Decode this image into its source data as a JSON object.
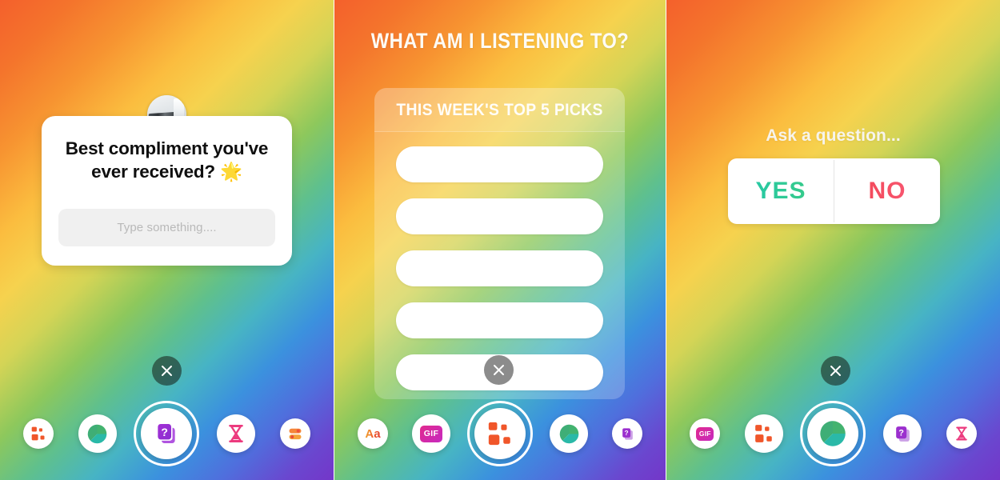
{
  "app": {
    "name": "instagram-story-stickers",
    "panel_count": 3
  },
  "theme": {
    "background_gradient": [
      "#f4602c",
      "#fbbd3f",
      "#8dc85c",
      "#3b91de",
      "#7436c9"
    ],
    "sticker_white": "#ffffff",
    "yes_color_start": "#1fc8b0",
    "yes_color_end": "#3ecb7e",
    "no_color_start": "#f0414d",
    "no_color_end": "#fb5f7e",
    "quiz_orange": "#f0562a",
    "gif_pink": "#e12a8e",
    "question_purple": "#9b2fce",
    "countdown_pink": "#ec3a7e",
    "poll_green": "#2fab6e"
  },
  "panels": {
    "left": {
      "name": "questions-sticker-panel",
      "sticker": {
        "avatar_name": "user-avatar",
        "prompt": "Best compliment you've ever received? 🌟",
        "input_placeholder": "Type something...."
      },
      "close_label": "×",
      "toolbar": [
        {
          "name": "quiz-sticker",
          "icon": "quiz-blocks-icon",
          "label": "",
          "size": "s",
          "selected": false
        },
        {
          "name": "poll-sticker",
          "icon": "poll-pie-icon",
          "label": "",
          "size": "m",
          "selected": false
        },
        {
          "name": "questions-sticker",
          "icon": "questions-card-icon",
          "label": "",
          "size": "l",
          "selected": true
        },
        {
          "name": "countdown-sticker",
          "icon": "countdown-hourglass-icon",
          "label": "",
          "size": "m",
          "selected": false
        },
        {
          "name": "slider-sticker",
          "icon": "emoji-slider-icon",
          "label": "",
          "size": "s",
          "selected": false
        }
      ]
    },
    "middle": {
      "name": "quiz-sticker-panel",
      "title": "WHAT AM I LISTENING TO?",
      "card": {
        "header": "THIS WEEK'S TOP 5 PICKS",
        "rows": [
          "",
          "",
          "",
          "",
          ""
        ],
        "row_count": 5
      },
      "close_label": "×",
      "toolbar": [
        {
          "name": "text-sticker",
          "icon": "text-aa-icon",
          "label": "Aa",
          "size": "s",
          "selected": false
        },
        {
          "name": "gif-sticker",
          "icon": "gif-icon",
          "label": "GIF",
          "size": "m",
          "selected": false
        },
        {
          "name": "quiz-sticker",
          "icon": "quiz-blocks-icon",
          "label": "",
          "size": "l",
          "selected": true
        },
        {
          "name": "poll-sticker",
          "icon": "poll-pie-icon",
          "label": "",
          "size": "m",
          "selected": false
        },
        {
          "name": "questions-sticker",
          "icon": "questions-card-icon",
          "label": "",
          "size": "s",
          "selected": false
        }
      ]
    },
    "right": {
      "name": "poll-sticker-panel",
      "title": "Ask a question...",
      "poll": {
        "yes_label": "YES",
        "no_label": "NO"
      },
      "close_label": "×",
      "toolbar": [
        {
          "name": "gif-sticker",
          "icon": "gif-icon",
          "label": "GIF",
          "size": "s",
          "selected": false
        },
        {
          "name": "quiz-sticker",
          "icon": "quiz-blocks-icon",
          "label": "",
          "size": "m",
          "selected": false
        },
        {
          "name": "poll-sticker",
          "icon": "poll-pie-icon",
          "label": "",
          "size": "l",
          "selected": true
        },
        {
          "name": "questions-sticker",
          "icon": "questions-card-icon",
          "label": "",
          "size": "m",
          "selected": false
        },
        {
          "name": "countdown-sticker",
          "icon": "countdown-hourglass-icon",
          "label": "",
          "size": "s",
          "selected": false
        }
      ]
    }
  }
}
